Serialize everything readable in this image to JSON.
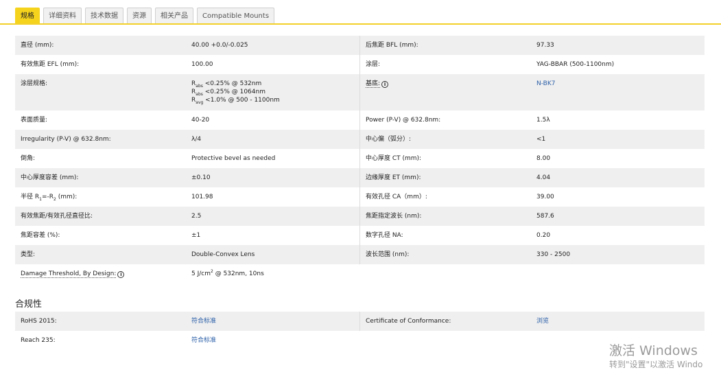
{
  "tabs": [
    {
      "label": "规格",
      "active": true
    },
    {
      "label": "详细资料"
    },
    {
      "label": "技术数据"
    },
    {
      "label": "资源"
    },
    {
      "label": "相关产品"
    },
    {
      "label": "Compatible Mounts"
    }
  ],
  "specs": {
    "diameter_label": "直径 (mm):",
    "diameter_value": "40.00 +0.0/-0.025",
    "bfl_label": "后焦距 BFL (mm):",
    "bfl_value": "97.33",
    "efl_label": "有效焦距 EFL (mm):",
    "efl_value": "100.00",
    "coating_label": "涂层:",
    "coating_value": "YAG-BBAR (500-1100nm)",
    "coating_spec_label": "涂层规格:",
    "coating_spec_line1_sub": "abs",
    "coating_spec_line1_rest": " <0.25% @ 532nm",
    "coating_spec_line2_sub": "abs",
    "coating_spec_line2_rest": " <0.25% @ 1064nm",
    "coating_spec_line3_sub": "avg",
    "coating_spec_line3_rest": " <1.0% @ 500 - 1100nm",
    "coating_spec_prefix": "R",
    "substrate_label": "基底:",
    "substrate_value": "N-BK7",
    "surface_quality_label": "表面质量:",
    "surface_quality_value": "40-20",
    "power_label": "Power (P-V) @ 632.8nm:",
    "power_value": "1.5λ",
    "irregularity_label": "Irregularity (P-V) @ 632.8nm:",
    "irregularity_value": "λ/4",
    "centering_label": "中心偏（弧分）:",
    "centering_value": "<1",
    "bevel_label": "倒角:",
    "bevel_value": "Protective bevel as needed",
    "ct_label": "中心厚度 CT (mm):",
    "ct_value": "8.00",
    "ct_tol_label": "中心厚度容差 (mm):",
    "ct_tol_value": "±0.10",
    "et_label": "边缘厚度 ET (mm):",
    "et_value": "4.04",
    "radius_label_pre": "半径 R",
    "radius_sub1": "1",
    "radius_label_mid": "=-R",
    "radius_sub2": "2",
    "radius_label_post": " (mm):",
    "radius_value": "101.98",
    "ca_label": "有效孔径 CA（mm）:",
    "ca_value": "39.00",
    "fnum_label": "有效焦距/有效孔径直径比:",
    "fnum_value": "2.5",
    "design_wl_label": "焦距指定波长 (nm):",
    "design_wl_value": "587.6",
    "focal_tol_label": "焦距容差 (%):",
    "focal_tol_value": "±1",
    "na_label": "数字孔径 NA:",
    "na_value": "0.20",
    "type_label": "类型:",
    "type_value": "Double-Convex Lens",
    "wl_range_label": "波长范围 (nm):",
    "wl_range_value": "330 - 2500",
    "damage_label": "Damage Threshold, By Design:",
    "damage_value_pre": "5 J/cm",
    "damage_value_sup": "2",
    "damage_value_post": " @ 532nm, 10ns"
  },
  "compliance": {
    "title": "合规性",
    "rohs_label": "RoHS 2015:",
    "rohs_value": "符合标准",
    "coc_label": "Certificate of Conformance:",
    "coc_value": "浏览",
    "reach_label": "Reach 235:",
    "reach_value": "符合标准"
  },
  "watermark": {
    "line1": "激活 Windows",
    "line2": "转到\"设置\"以激活 Windo"
  }
}
